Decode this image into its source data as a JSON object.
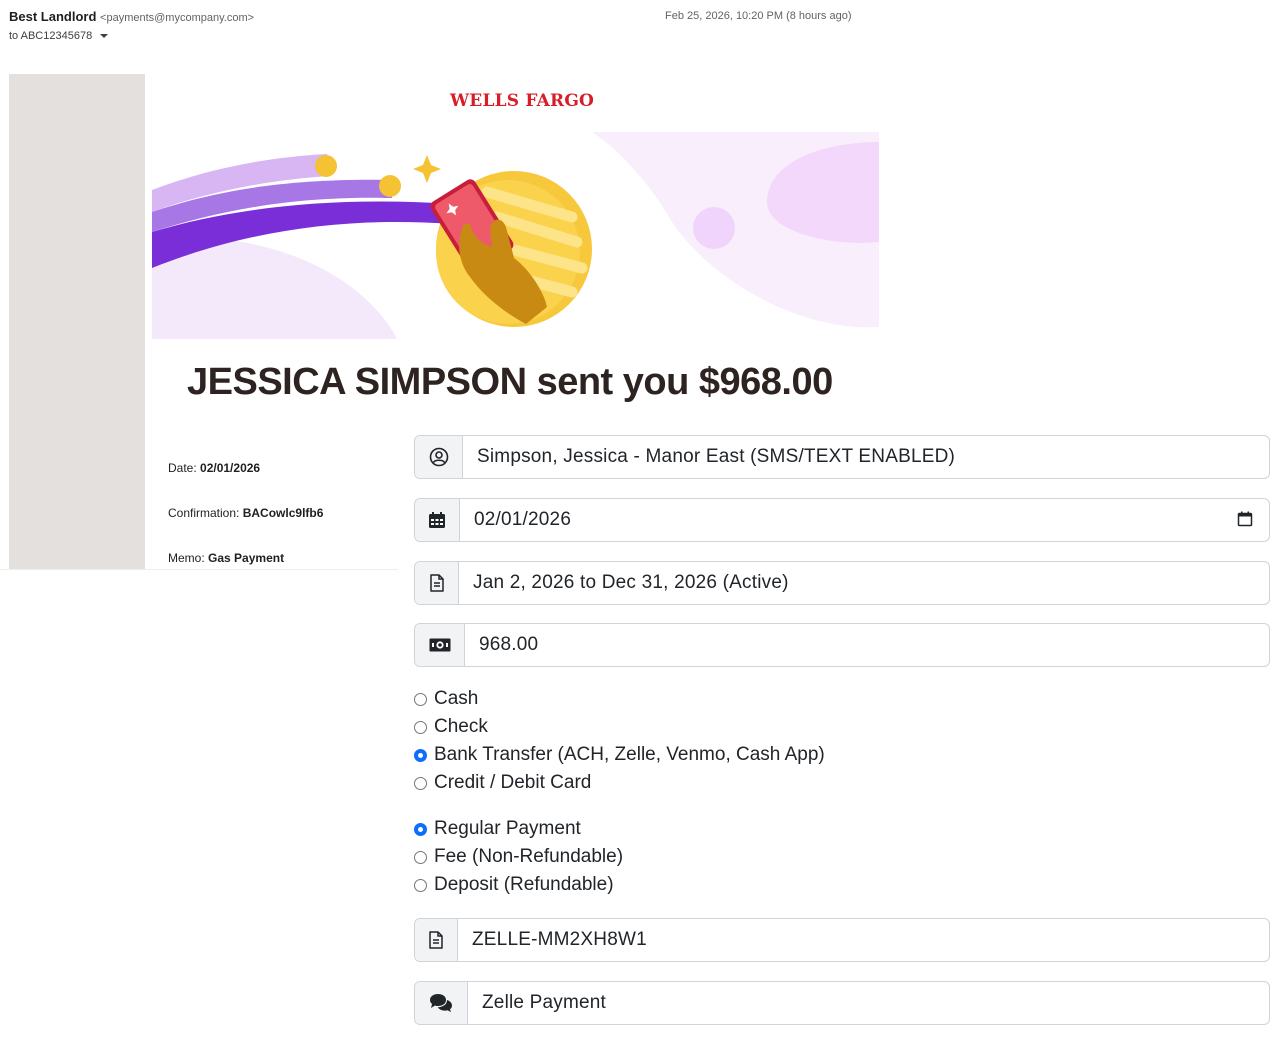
{
  "email": {
    "sender_name": "Best Landlord",
    "sender_email": "<payments@mycompany.com>",
    "to_label": "to ABC12345678",
    "timestamp": "Feb 25, 2026, 10:20 PM (8 hours ago)"
  },
  "message": {
    "brand": "WELLS FARGO",
    "headline": "JESSICA SIMPSON sent you $968.00",
    "details": {
      "date_label": "Date:",
      "date_value": "02/01/2026",
      "confirmation_label": "Confirmation:",
      "confirmation_value": "BACowlc9lfb6",
      "memo_label": "Memo:",
      "memo_value": "Gas Payment"
    }
  },
  "form": {
    "tenant": "Simpson, Jessica - Manor East (SMS/TEXT ENABLED)",
    "date": "02/01/2026",
    "lease": "Jan 2, 2026 to Dec 31, 2026 (Active)",
    "amount": "968.00",
    "payment_methods": [
      {
        "label": "Cash",
        "checked": false
      },
      {
        "label": "Check",
        "checked": false
      },
      {
        "label": "Bank Transfer (ACH, Zelle, Venmo, Cash App)",
        "checked": true
      },
      {
        "label": "Credit / Debit Card",
        "checked": false
      }
    ],
    "payment_types": [
      {
        "label": "Regular Payment",
        "checked": true
      },
      {
        "label": "Fee (Non-Refundable)",
        "checked": false
      },
      {
        "label": "Deposit (Refundable)",
        "checked": false
      }
    ],
    "reference": "ZELLE-MM2XH8W1",
    "notes": "Zelle Payment"
  },
  "icons": {
    "tenant": "user-circle-icon",
    "date": "calendar-icon",
    "lease": "document-icon",
    "amount": "money-bill-icon",
    "reference": "document-icon",
    "notes": "comments-icon",
    "date_picker": "calendar-outline-icon"
  },
  "colors": {
    "brand_red": "#d71e28",
    "accent_blue": "#0d6efd",
    "headline": "#2d2421"
  }
}
